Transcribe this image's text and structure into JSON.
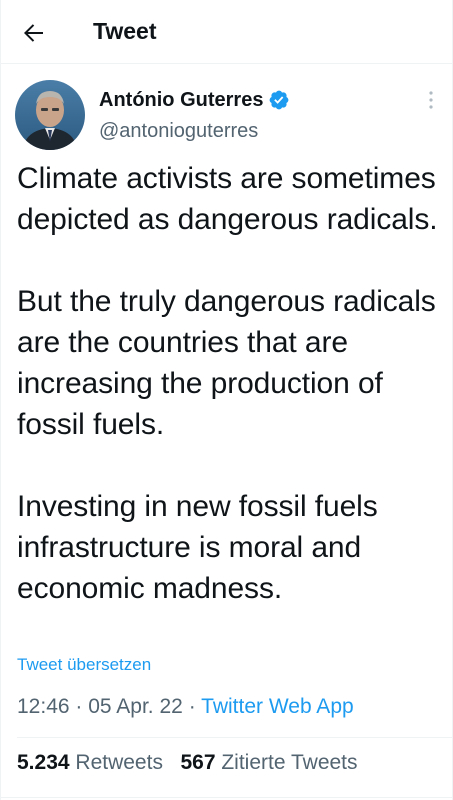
{
  "header": {
    "title": "Tweet",
    "back_icon": "arrow-left-icon"
  },
  "author": {
    "display_name": "António Guterres",
    "handle": "@antonioguterres",
    "verified_icon": "verified-badge-icon",
    "verified_color": "#1d9bf0"
  },
  "tweet": {
    "paragraphs": [
      "Climate activists are sometimes depicted as dangerous radicals.",
      "But the truly dangerous radicals are the countries that are increasing the production of fossil fuels.",
      "Investing in new fossil fuels infrastructure is moral and economic madness."
    ],
    "translate_label": "Tweet übersetzen"
  },
  "meta": {
    "time": "12:46",
    "separator": "·",
    "date": "05 Apr. 22",
    "source": "Twitter Web App"
  },
  "stats": {
    "retweets_count": "5.234",
    "retweets_label": "Retweets",
    "quotes_count": "567",
    "quotes_label": "Zitierte Tweets"
  },
  "colors": {
    "accent": "#1d9bf0",
    "text_primary": "#0f1419",
    "text_secondary": "#536471",
    "border": "#eff3f4"
  }
}
